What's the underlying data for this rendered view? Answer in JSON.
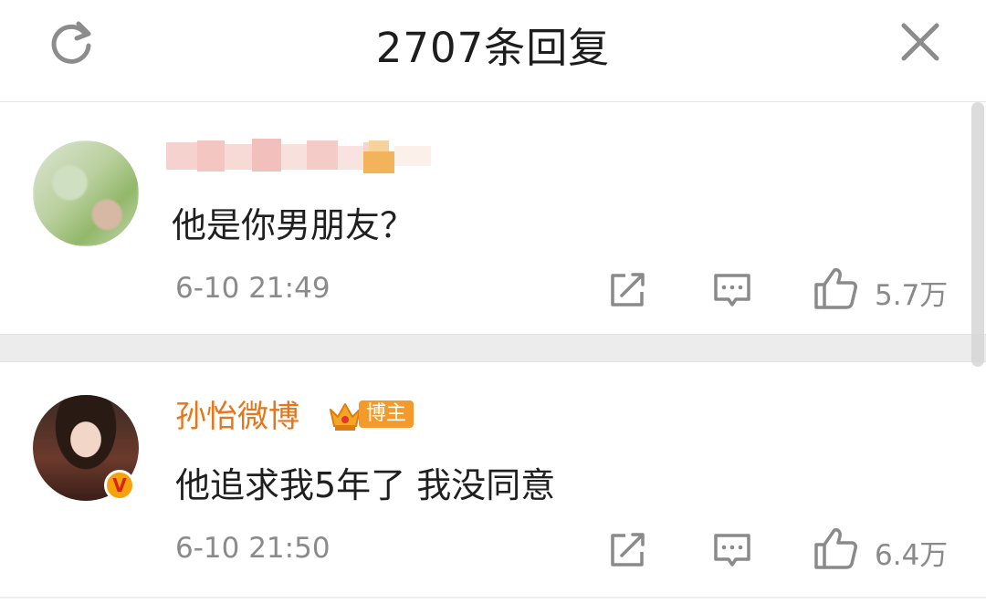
{
  "header": {
    "title": "2707条回复",
    "refresh_icon": "refresh-icon",
    "close_icon": "close-icon"
  },
  "comments": [
    {
      "user": {
        "name": "",
        "name_blurred": true,
        "avatar": "blurred-avatar"
      },
      "text": "他是你男朋友？",
      "time": "6-10 21:49",
      "likes": "5.7万"
    },
    {
      "user": {
        "name": "孙怡微博",
        "avatar": "portrait-avatar",
        "verified_badge": "V",
        "tag": "博主"
      },
      "text": "他追求我5年了 我没同意",
      "time": "6-10 21:50",
      "likes": "6.4万"
    }
  ],
  "colors": {
    "name_orange": "#e8751a",
    "tag_bg": "#f29b2c",
    "meta_gray": "#8a8a8a",
    "divider_gray": "#ececec"
  }
}
